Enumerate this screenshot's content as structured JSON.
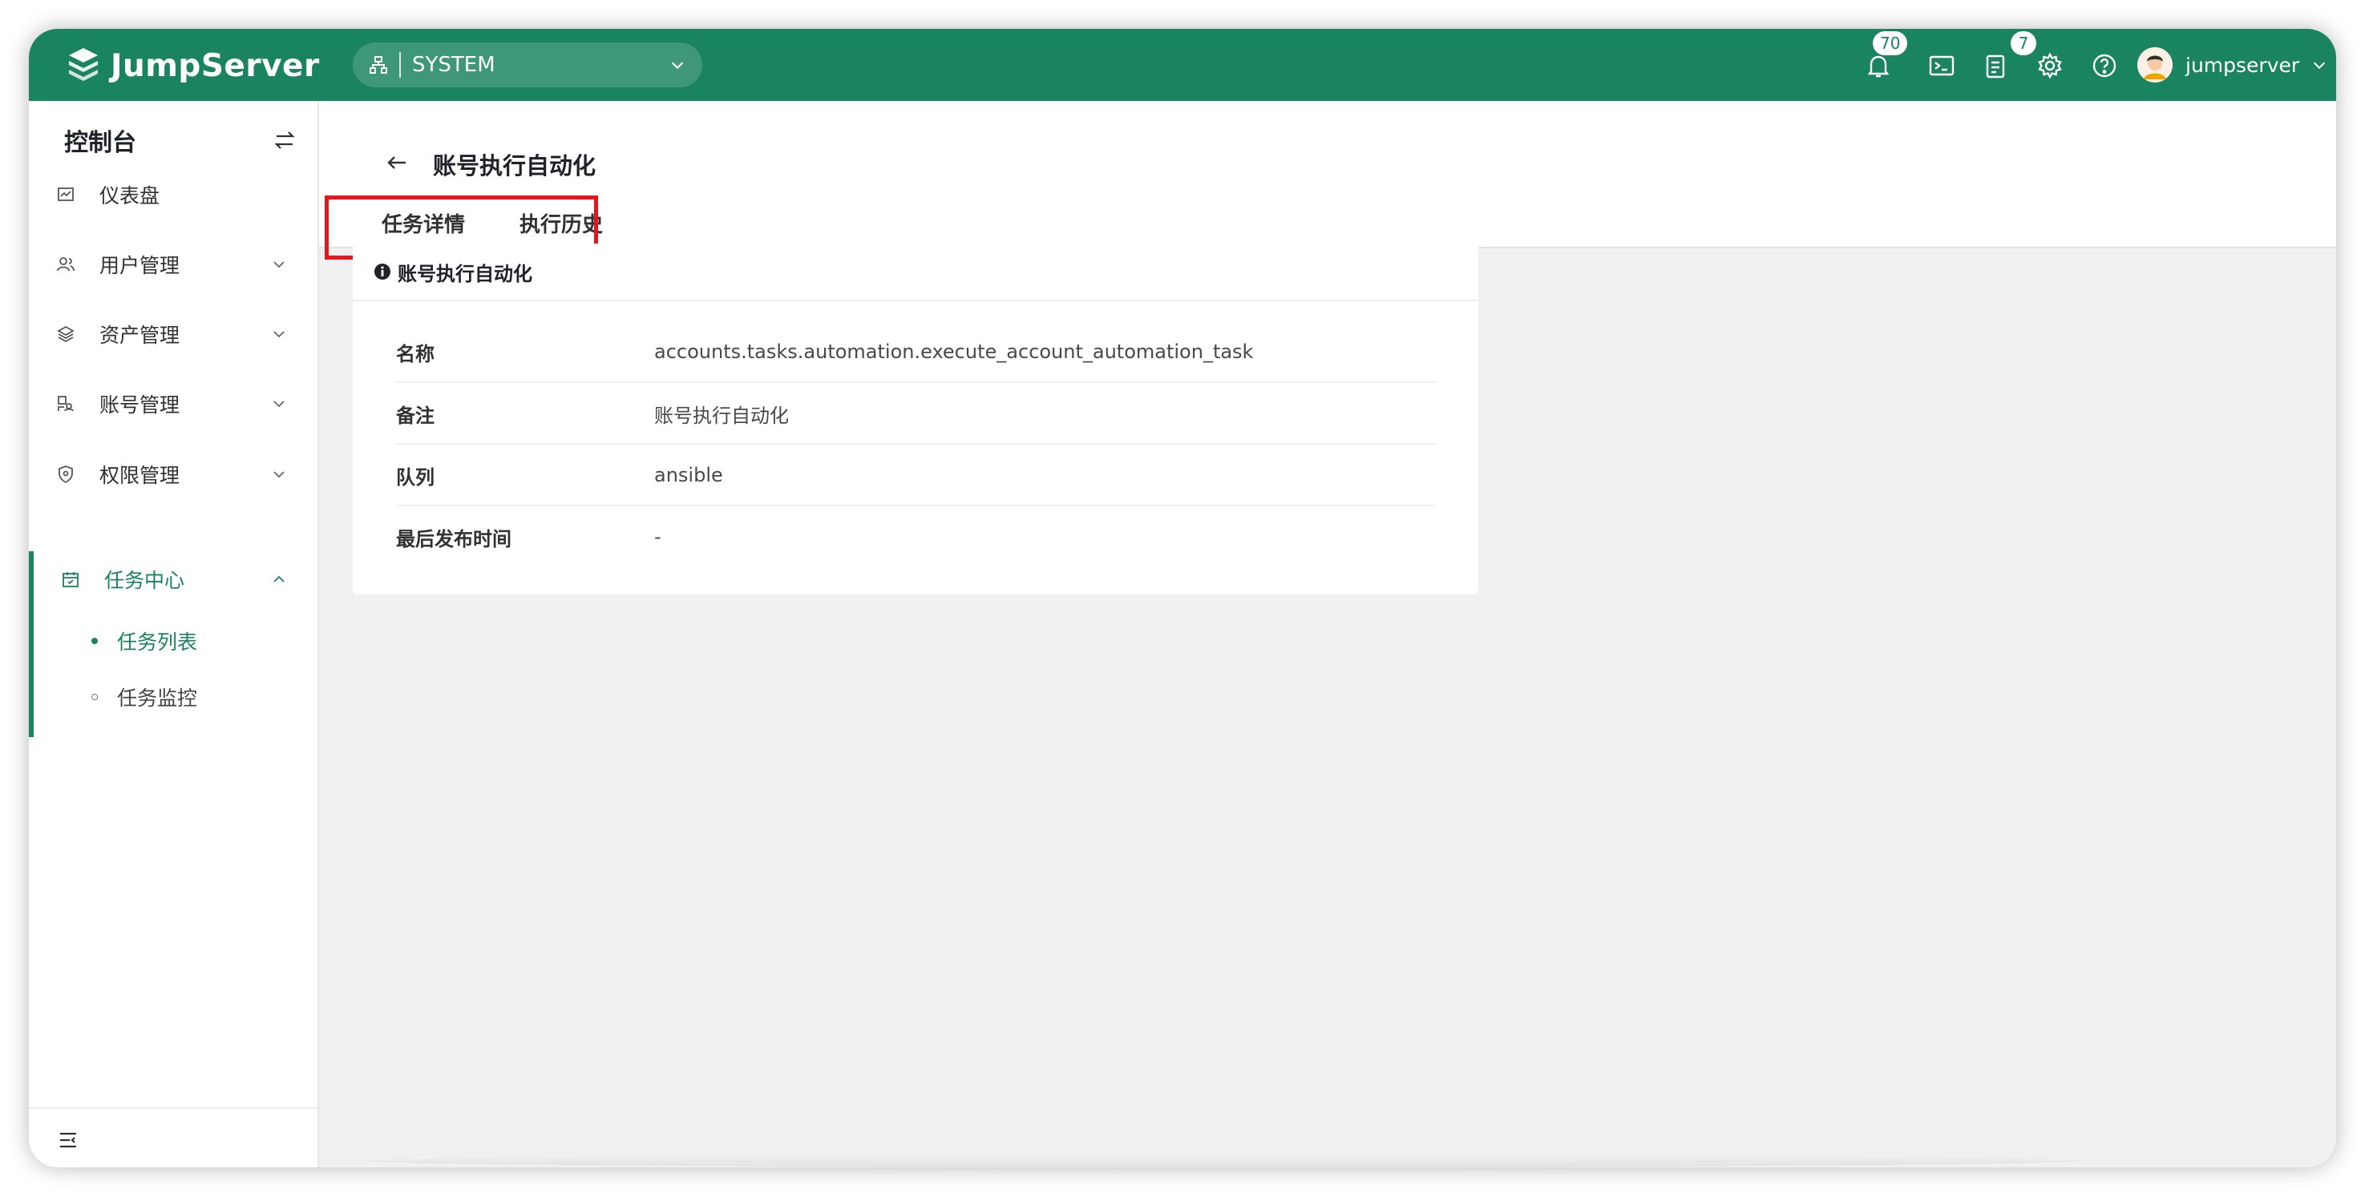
{
  "header": {
    "brand": "JumpServer",
    "org_label": "SYSTEM",
    "notifications_badge": "70",
    "tickets_badge": "7",
    "username": "jumpserver",
    "accent": "#1a8360"
  },
  "sidebar": {
    "title": "控制台",
    "items": [
      {
        "label": "仪表盘",
        "icon": "dashboard-icon"
      },
      {
        "label": "用户管理",
        "icon": "users-icon"
      },
      {
        "label": "资产管理",
        "icon": "assets-icon"
      },
      {
        "label": "账号管理",
        "icon": "accounts-icon"
      },
      {
        "label": "权限管理",
        "icon": "permissions-icon"
      },
      {
        "label": "任务中心",
        "icon": "calendar-icon"
      }
    ],
    "sub_items": [
      {
        "label": "任务列表",
        "active": true
      },
      {
        "label": "任务监控",
        "active": false
      }
    ]
  },
  "page": {
    "title": "账号执行自动化",
    "tabs": [
      {
        "label": "任务详情",
        "active": true
      },
      {
        "label": "执行历史",
        "active": false
      }
    ]
  },
  "card": {
    "title": "账号执行自动化",
    "rows": [
      {
        "key": "名称",
        "value": "accounts.tasks.automation.execute_account_automation_task"
      },
      {
        "key": "备注",
        "value": "账号执行自动化"
      },
      {
        "key": "队列",
        "value": "ansible"
      },
      {
        "key": "最后发布时间",
        "value": "-"
      }
    ]
  }
}
